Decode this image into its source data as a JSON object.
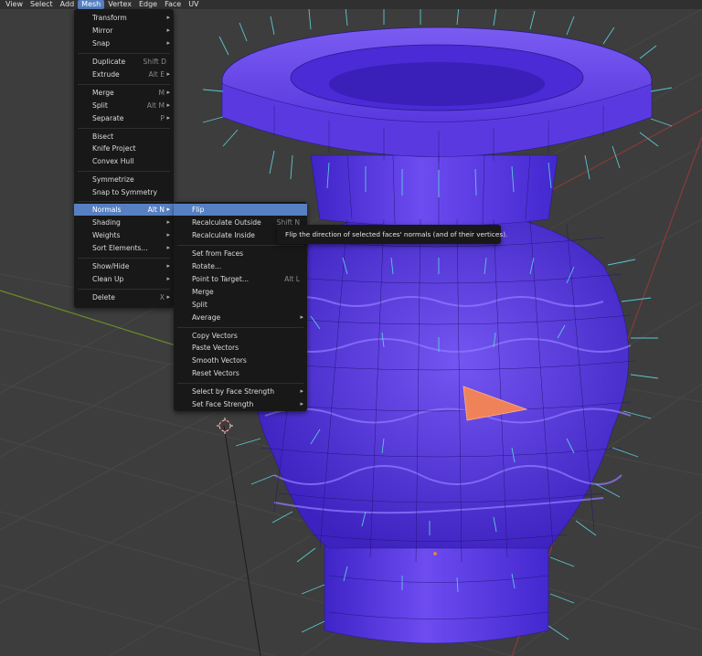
{
  "header": {
    "menus": [
      {
        "label": "View"
      },
      {
        "label": "Select"
      },
      {
        "label": "Add"
      },
      {
        "label": "Mesh",
        "active": true
      },
      {
        "label": "Vertex"
      },
      {
        "label": "Edge"
      },
      {
        "label": "Face"
      },
      {
        "label": "UV"
      }
    ]
  },
  "mesh_menu": {
    "items": [
      {
        "label": "Transform",
        "shortcut": "",
        "submenu": true
      },
      {
        "label": "Mirror",
        "shortcut": "",
        "submenu": true
      },
      {
        "label": "Snap",
        "shortcut": "",
        "submenu": true
      },
      {
        "label": "Duplicate",
        "shortcut": "Shift D",
        "submenu": false
      },
      {
        "label": "Extrude",
        "shortcut": "Alt E",
        "submenu": true
      },
      {
        "label": "Merge",
        "shortcut": "M",
        "submenu": true
      },
      {
        "label": "Split",
        "shortcut": "Alt M",
        "submenu": true
      },
      {
        "label": "Separate",
        "shortcut": "P",
        "submenu": true
      },
      {
        "label": "Bisect",
        "shortcut": "",
        "submenu": false
      },
      {
        "label": "Knife Project",
        "shortcut": "",
        "submenu": false
      },
      {
        "label": "Convex Hull",
        "shortcut": "",
        "submenu": false
      },
      {
        "label": "Symmetrize",
        "shortcut": "",
        "submenu": false
      },
      {
        "label": "Snap to Symmetry",
        "shortcut": "",
        "submenu": false
      },
      {
        "label": "Normals",
        "shortcut": "Alt N",
        "submenu": true,
        "highlighted": true
      },
      {
        "label": "Shading",
        "shortcut": "",
        "submenu": true
      },
      {
        "label": "Weights",
        "shortcut": "",
        "submenu": true
      },
      {
        "label": "Sort Elements...",
        "shortcut": "",
        "submenu": true
      },
      {
        "label": "Show/Hide",
        "shortcut": "",
        "submenu": true
      },
      {
        "label": "Clean Up",
        "shortcut": "",
        "submenu": true
      },
      {
        "label": "Delete",
        "shortcut": "X",
        "submenu": true
      }
    ]
  },
  "normals_menu": {
    "items": [
      {
        "label": "Flip",
        "shortcut": "",
        "submenu": false,
        "highlighted": true
      },
      {
        "label": "Recalculate Outside",
        "shortcut": "Shift N",
        "submenu": false
      },
      {
        "label": "Recalculate Inside",
        "shortcut": "Shi",
        "submenu": false
      },
      {
        "label": "Set from Faces",
        "shortcut": "",
        "submenu": false
      },
      {
        "label": "Rotate...",
        "shortcut": "",
        "submenu": false
      },
      {
        "label": "Point to Target...",
        "shortcut": "Alt L",
        "submenu": false
      },
      {
        "label": "Merge",
        "shortcut": "",
        "submenu": false
      },
      {
        "label": "Split",
        "shortcut": "",
        "submenu": false
      },
      {
        "label": "Average",
        "shortcut": "",
        "submenu": true
      },
      {
        "label": "Copy Vectors",
        "shortcut": "",
        "submenu": false
      },
      {
        "label": "Paste Vectors",
        "shortcut": "",
        "submenu": false
      },
      {
        "label": "Smooth Vectors",
        "shortcut": "",
        "submenu": false
      },
      {
        "label": "Reset Vectors",
        "shortcut": "",
        "submenu": false
      },
      {
        "label": "Select by Face Strength",
        "shortcut": "",
        "submenu": true
      },
      {
        "label": "Set Face Strength",
        "shortcut": "",
        "submenu": true
      }
    ]
  },
  "tooltip": {
    "text": "Flip the direction of selected faces' normals (and of their vertices)."
  },
  "colors": {
    "accent": "#5680c2",
    "menu_bg": "#181818",
    "viewport_bg": "#3d3d3d",
    "mesh_face": "#6a45e8",
    "normal_lines": "#5fd6e0",
    "selected_face": "#f0825a"
  },
  "icons": [
    "submenu-arrow-icon",
    "3d-cursor-icon"
  ]
}
